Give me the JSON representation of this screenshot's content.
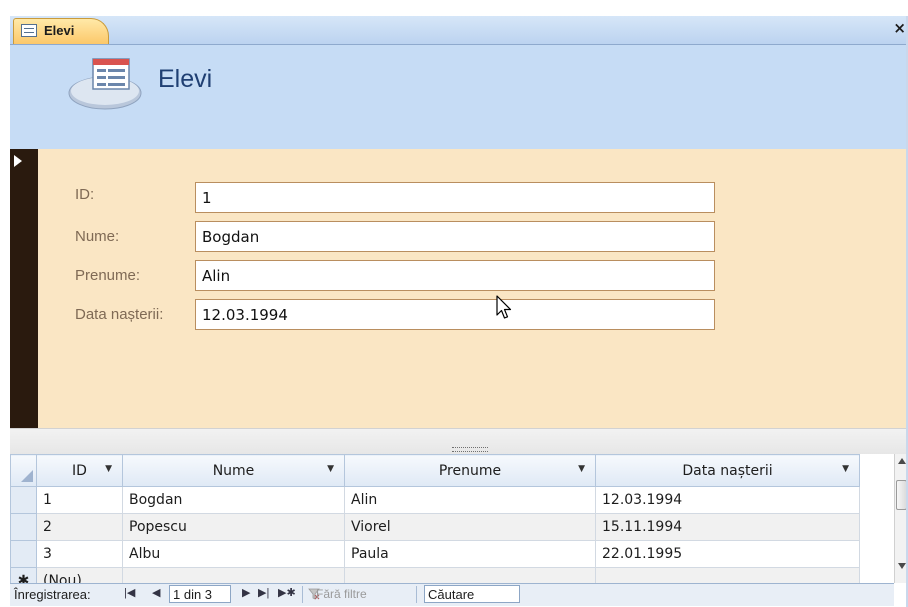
{
  "window": {
    "tab_label": "Elevi",
    "close_glyph": "×"
  },
  "header": {
    "title": "Elevi"
  },
  "form": {
    "current_record_marker": "▶",
    "fields": [
      {
        "label": "ID:",
        "value": "1"
      },
      {
        "label": "Nume:",
        "value": "Bogdan"
      },
      {
        "label": "Prenume:",
        "value": "Alin"
      },
      {
        "label": "Data nașterii:",
        "value": "12.03.1994"
      }
    ]
  },
  "datasheet": {
    "columns": [
      "ID",
      "Nume",
      "Prenume",
      "Data nașterii"
    ],
    "rows": [
      [
        "1",
        "Bogdan",
        "Alin",
        "12.03.1994"
      ],
      [
        "2",
        "Popescu",
        "Viorel",
        "15.11.1994"
      ],
      [
        "3",
        "Albu",
        "Paula",
        "22.01.1995"
      ]
    ],
    "new_row_marker": "✱",
    "new_row_label": "(Nou)"
  },
  "navigation": {
    "label": "Înregistrarea:",
    "first": "|◀",
    "prev": "◀",
    "record_position": "1 din 3",
    "next": "▶",
    "last": "▶|",
    "new_record": "▶✱",
    "filter_label": "Fără filtre",
    "search_label": "Căutare"
  },
  "colors": {
    "header_bg": "#c6dcf5",
    "detail_bg": "#fae6c4",
    "title_color": "#1f3f73",
    "label_color": "#7f6a55",
    "field_border": "#b98e5f",
    "record_selector": "#2a1a0e"
  },
  "icons": [
    "form-icon",
    "close-icon",
    "mouse-pointer-icon",
    "scroll-up-icon",
    "scroll-down-icon",
    "filter-icon"
  ]
}
